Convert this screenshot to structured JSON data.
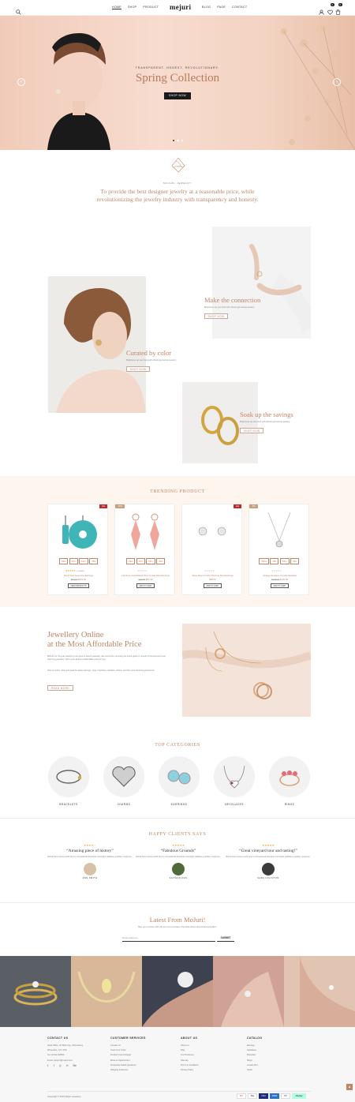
{
  "header": {
    "logo": "mejuri",
    "nav_left": [
      "HOME",
      "SHOP",
      "PRODUCT"
    ],
    "nav_right": [
      "BLOG",
      "PAGE",
      "CONTACT"
    ],
    "wishlist_count": "0",
    "cart_count": "0"
  },
  "hero": {
    "tagline": "TRANSPARENT. HONEST. REVOLUTIONARY.",
    "title": "Spring Collection",
    "button": "SHOP NOW"
  },
  "intro": {
    "brand": "MOJURI JEWELRY",
    "text": "To provide the best designer jewelry at a reasonable price, while revolutionizing the jewelry industry with transparency and honesty."
  },
  "features": [
    {
      "title": "Make the connection",
      "desc": "Brightness up your look with vibrant gemstones jewelry.",
      "button": "SHOP NOW"
    },
    {
      "title": "Curated by color",
      "desc": "Brightness up your look with vibrant gemstones jewelry.",
      "button": "SHOP NOW"
    },
    {
      "title": "Soak up the savings",
      "desc": "Brightness up your look with vibrant gemstones jewelry.",
      "button": "SHOP NOW"
    }
  ],
  "trending": {
    "title": "TRENDING PRODUCT",
    "products": [
      {
        "badge": "Hot",
        "badge_color": "#b52f2f",
        "countdown": [
          "29d",
          "15h",
          "53m",
          "38s"
        ],
        "reviews": "1 review",
        "name": "Pearl Stud Turquoise Earrings",
        "old_price": "$90.00",
        "price": "$264.00",
        "button": "VIEW PRODUCTS"
      },
      {
        "badge": "-20%",
        "badge_color": "#c9a07e",
        "countdown": [
          "29d",
          "15h",
          "53m",
          "38s"
        ],
        "reviews": "",
        "name": "14k Rose Gold Plated Pink Crystal Drop Earrings",
        "old_price": "$70.00",
        "price": "$56.00",
        "button": "ADD TO CART"
      },
      {
        "badge": "Hot",
        "badge_color": "#b52f2f",
        "countdown": [],
        "reviews": "",
        "name": "Silver Round Cubic Zirconia Stud Earrings",
        "old_price": "",
        "price": "$38.00",
        "button": "ADD TO CART"
      },
      {
        "badge": "-5%",
        "badge_color": "#c9a07e",
        "countdown": [
          "330d",
          "15h",
          "53m",
          "38s"
        ],
        "reviews": "",
        "name": "Vintage Hexagon Crystal Necklace",
        "old_price": "$128.00",
        "price": "$120.00",
        "button": "ADD TO CART"
      }
    ]
  },
  "promo": {
    "title_line1": "Jewellery Online",
    "title_line2": "at the Most Affordable Price",
    "para1": "Behind our 10-year passion to our pivot of launch jewellery has come from pursuing the entire globe in pursuit of the best and most charming jewellery. Visit us for all kind of affordable price for you.",
    "para2": "Visit us online, shop and deal the latest earrings, rings, bracelets, necklace, chains, and the most luxurious gemstones.",
    "button": "READ MORE"
  },
  "categories": {
    "title": "TOP CATEGORIES",
    "items": [
      "BRACELETS",
      "CHARMS",
      "EARRINGS",
      "NECKLACES",
      "RINGS"
    ]
  },
  "testimonials": {
    "title": "HAPPY CLIENTS SAYS",
    "items": [
      {
        "quote": "Amazing piece of history",
        "text": "Blood bank canine teeth larynx occupational therapist oncologist palliative pupillary response.",
        "name": "ANN SMITH"
      },
      {
        "quote": "Fabulous Grounds",
        "text": "Blood bank canine teeth larynx occupational therapist oncologist palliative pupillary response.",
        "name": "SAITHAN DAS"
      },
      {
        "quote": "Great vineyard tour and tasting!",
        "text": "Blood bank canine teeth larynx occupational therapist oncologist palliative pupillary response.",
        "name": "SARA COLINTON"
      }
    ]
  },
  "newsletter": {
    "title": "Latest From MoJuri!",
    "subtitle": "Sign up to receive 10% off your next purchase. Plus hear about new arrivals and offers.",
    "placeholder": "Email address...",
    "button": "SUBMIT"
  },
  "footer": {
    "contact": {
      "title": "CONTACT US",
      "lines": [
        "Head Office: 26 Wyle Cop, Shrewsbury,",
        "Shropshire, SY1 1XD",
        "Tel: 01743 234500",
        "Email: support@mojuri.com"
      ]
    },
    "services": {
      "title": "CUSTOMER SERVICES",
      "links": [
        "Contact Us",
        "Track Your Order",
        "Product Care & Repair",
        "Book an Appointment",
        "Frequently Asked Questions",
        "Shipping & Returns"
      ]
    },
    "about": {
      "title": "ABOUT US",
      "links": [
        "About Us",
        "FAQ",
        "Our Producers",
        "Sitemap",
        "Terms & Conditions",
        "Privacy Policy"
      ]
    },
    "catalog": {
      "title": "CATALOG",
      "links": [
        "Earrings",
        "Necklaces",
        "Bracelets",
        "Rings",
        "Jewelry Box",
        "Studs"
      ]
    },
    "copyright": "Copyright © 2023 Mojuri Jewellery",
    "payments": [
      "MC",
      "Pay",
      "VISA",
      "AMEX",
      "PP",
      "Afterpay"
    ]
  },
  "colors": {
    "accent": "#c08466",
    "hero_bg": "#f6d9cc",
    "section_bg": "#fdf5ee"
  }
}
